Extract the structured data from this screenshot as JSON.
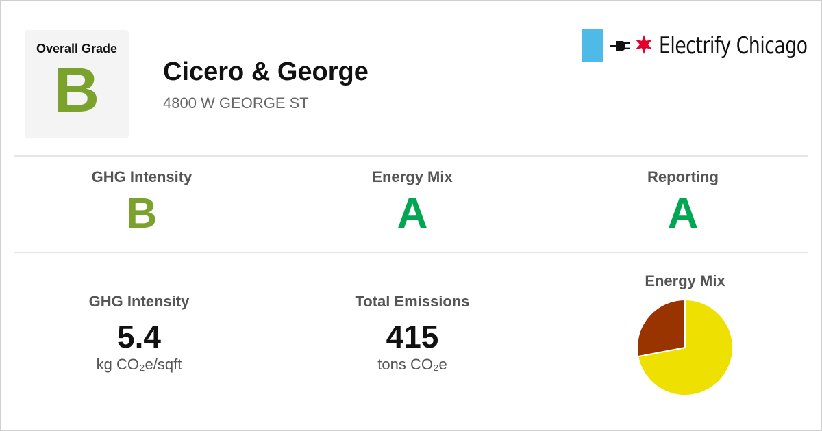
{
  "header": {
    "overall_label": "Overall Grade",
    "overall_grade": "B",
    "building_name": "Cicero & George",
    "address": "4800 W GEORGE ST"
  },
  "brand": {
    "name": "Electrify Chicago",
    "flag_icon": "chicago-flag-icon",
    "plug_icon": "plug-icon",
    "star_icon": "red-star-icon"
  },
  "grades": [
    {
      "label": "GHG Intensity",
      "grade": "B"
    },
    {
      "label": "Energy Mix",
      "grade": "A"
    },
    {
      "label": "Reporting",
      "grade": "A"
    }
  ],
  "metrics": {
    "ghg": {
      "label": "GHG Intensity",
      "value": "5.4",
      "unit": "kg CO₂e/sqft"
    },
    "emissions": {
      "label": "Total Emissions",
      "value": "415",
      "unit": "tons CO₂e"
    },
    "mix": {
      "label": "Energy Mix"
    }
  },
  "colors": {
    "grade_b": "#7aa22d",
    "grade_a": "#00a651",
    "flag_blue": "#4fb9e8",
    "star_red": "#e4002b",
    "pie_electric": "#eee000",
    "pie_gas": "#993300"
  },
  "chart_data": {
    "type": "pie",
    "title": "Energy Mix",
    "slices": [
      {
        "color": "#eee000",
        "value": 0.72
      },
      {
        "color": "#993300",
        "value": 0.28
      }
    ]
  }
}
